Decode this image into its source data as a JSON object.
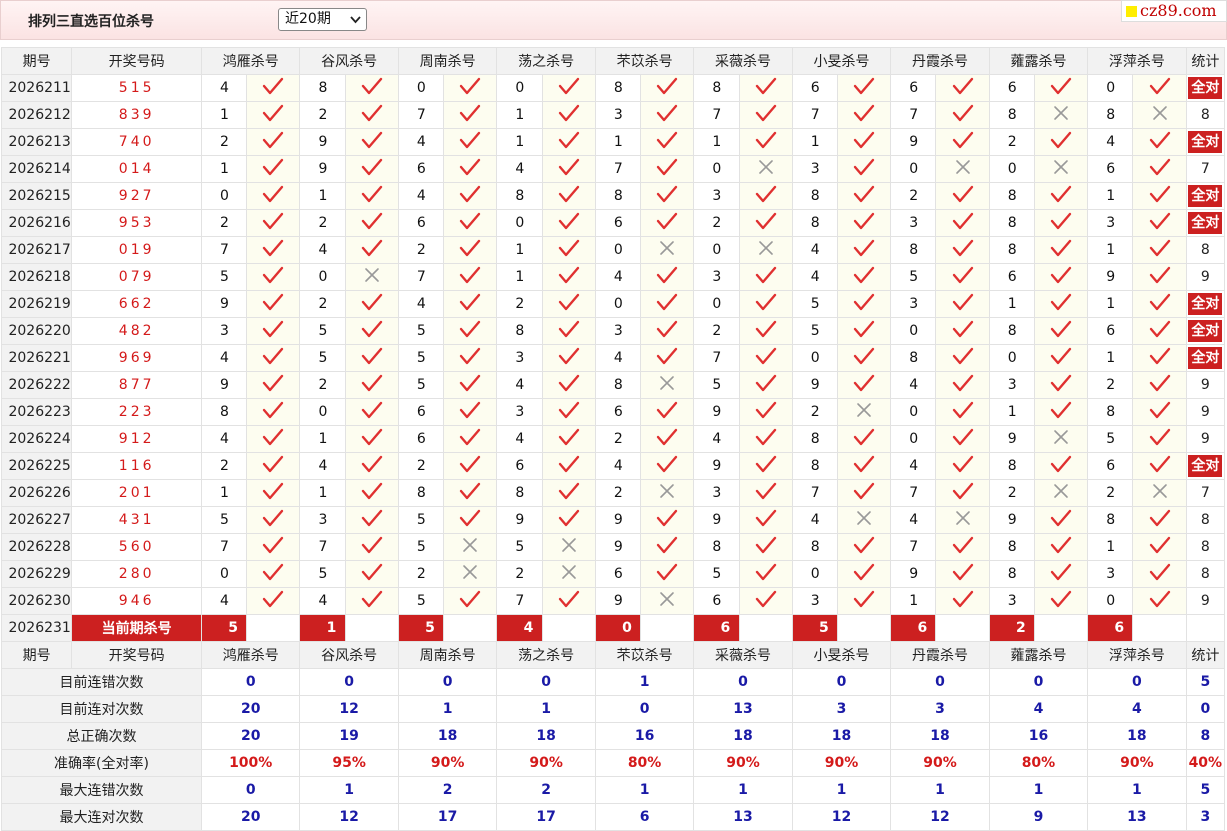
{
  "header": {
    "title": "排列三直选百位杀号",
    "period_select": "近20期",
    "watermark": "cz89.com"
  },
  "columns": {
    "issue": "期号",
    "draw": "开奖号码",
    "experts": [
      "鸿雁杀号",
      "谷风杀号",
      "周南杀号",
      "荡之杀号",
      "芣苡杀号",
      "采薇杀号",
      "小旻杀号",
      "丹霞杀号",
      "蕹露杀号",
      "浮萍杀号"
    ],
    "stat": "统计"
  },
  "rows": [
    {
      "issue": "2026211",
      "draw": "515",
      "kills": [
        4,
        8,
        0,
        0,
        8,
        8,
        6,
        6,
        6,
        0
      ],
      "hits": [
        1,
        1,
        1,
        1,
        1,
        1,
        1,
        1,
        1,
        1
      ],
      "stat": "全对"
    },
    {
      "issue": "2026212",
      "draw": "839",
      "kills": [
        1,
        2,
        7,
        1,
        3,
        7,
        7,
        7,
        8,
        8
      ],
      "hits": [
        1,
        1,
        1,
        1,
        1,
        1,
        1,
        1,
        0,
        0
      ],
      "stat": "8"
    },
    {
      "issue": "2026213",
      "draw": "740",
      "kills": [
        2,
        9,
        4,
        1,
        1,
        1,
        1,
        9,
        2,
        4
      ],
      "hits": [
        1,
        1,
        1,
        1,
        1,
        1,
        1,
        1,
        1,
        1
      ],
      "stat": "全对"
    },
    {
      "issue": "2026214",
      "draw": "014",
      "kills": [
        1,
        9,
        6,
        4,
        7,
        0,
        3,
        0,
        0,
        6
      ],
      "hits": [
        1,
        1,
        1,
        1,
        1,
        0,
        1,
        0,
        0,
        1
      ],
      "stat": "7"
    },
    {
      "issue": "2026215",
      "draw": "927",
      "kills": [
        0,
        1,
        4,
        8,
        8,
        3,
        8,
        2,
        8,
        1
      ],
      "hits": [
        1,
        1,
        1,
        1,
        1,
        1,
        1,
        1,
        1,
        1
      ],
      "stat": "全对"
    },
    {
      "issue": "2026216",
      "draw": "953",
      "kills": [
        2,
        2,
        6,
        0,
        6,
        2,
        8,
        3,
        8,
        3
      ],
      "hits": [
        1,
        1,
        1,
        1,
        1,
        1,
        1,
        1,
        1,
        1
      ],
      "stat": "全对"
    },
    {
      "issue": "2026217",
      "draw": "019",
      "kills": [
        7,
        4,
        2,
        1,
        0,
        0,
        4,
        8,
        8,
        1
      ],
      "hits": [
        1,
        1,
        1,
        1,
        0,
        0,
        1,
        1,
        1,
        1
      ],
      "stat": "8"
    },
    {
      "issue": "2026218",
      "draw": "079",
      "kills": [
        5,
        0,
        7,
        1,
        4,
        3,
        4,
        5,
        6,
        9
      ],
      "hits": [
        1,
        0,
        1,
        1,
        1,
        1,
        1,
        1,
        1,
        1
      ],
      "stat": "9"
    },
    {
      "issue": "2026219",
      "draw": "662",
      "kills": [
        9,
        2,
        4,
        2,
        0,
        0,
        5,
        3,
        1,
        1
      ],
      "hits": [
        1,
        1,
        1,
        1,
        1,
        1,
        1,
        1,
        1,
        1
      ],
      "stat": "全对"
    },
    {
      "issue": "2026220",
      "draw": "482",
      "kills": [
        3,
        5,
        5,
        8,
        3,
        2,
        5,
        0,
        8,
        6
      ],
      "hits": [
        1,
        1,
        1,
        1,
        1,
        1,
        1,
        1,
        1,
        1
      ],
      "stat": "全对"
    },
    {
      "issue": "2026221",
      "draw": "969",
      "kills": [
        4,
        5,
        5,
        3,
        4,
        7,
        0,
        8,
        0,
        1
      ],
      "hits": [
        1,
        1,
        1,
        1,
        1,
        1,
        1,
        1,
        1,
        1
      ],
      "stat": "全对"
    },
    {
      "issue": "2026222",
      "draw": "877",
      "kills": [
        9,
        2,
        5,
        4,
        8,
        5,
        9,
        4,
        3,
        2
      ],
      "hits": [
        1,
        1,
        1,
        1,
        0,
        1,
        1,
        1,
        1,
        1
      ],
      "stat": "9"
    },
    {
      "issue": "2026223",
      "draw": "223",
      "kills": [
        8,
        0,
        6,
        3,
        6,
        9,
        2,
        0,
        1,
        8
      ],
      "hits": [
        1,
        1,
        1,
        1,
        1,
        1,
        0,
        1,
        1,
        1
      ],
      "stat": "9"
    },
    {
      "issue": "2026224",
      "draw": "912",
      "kills": [
        4,
        1,
        6,
        4,
        2,
        4,
        8,
        0,
        9,
        5
      ],
      "hits": [
        1,
        1,
        1,
        1,
        1,
        1,
        1,
        1,
        0,
        1
      ],
      "stat": "9"
    },
    {
      "issue": "2026225",
      "draw": "116",
      "kills": [
        2,
        4,
        2,
        6,
        4,
        9,
        8,
        4,
        8,
        6
      ],
      "hits": [
        1,
        1,
        1,
        1,
        1,
        1,
        1,
        1,
        1,
        1
      ],
      "stat": "全对"
    },
    {
      "issue": "2026226",
      "draw": "201",
      "kills": [
        1,
        1,
        8,
        8,
        2,
        3,
        7,
        7,
        2,
        2
      ],
      "hits": [
        1,
        1,
        1,
        1,
        0,
        1,
        1,
        1,
        0,
        0
      ],
      "stat": "7"
    },
    {
      "issue": "2026227",
      "draw": "431",
      "kills": [
        5,
        3,
        5,
        9,
        9,
        9,
        4,
        4,
        9,
        8
      ],
      "hits": [
        1,
        1,
        1,
        1,
        1,
        1,
        0,
        0,
        1,
        1
      ],
      "stat": "8"
    },
    {
      "issue": "2026228",
      "draw": "560",
      "kills": [
        7,
        7,
        5,
        5,
        9,
        8,
        8,
        7,
        8,
        1
      ],
      "hits": [
        1,
        1,
        0,
        0,
        1,
        1,
        1,
        1,
        1,
        1
      ],
      "stat": "8"
    },
    {
      "issue": "2026229",
      "draw": "280",
      "kills": [
        0,
        5,
        2,
        2,
        6,
        5,
        0,
        9,
        8,
        3
      ],
      "hits": [
        1,
        1,
        0,
        0,
        1,
        1,
        1,
        1,
        1,
        1
      ],
      "stat": "8"
    },
    {
      "issue": "2026230",
      "draw": "946",
      "kills": [
        4,
        4,
        5,
        7,
        9,
        6,
        3,
        1,
        3,
        0
      ],
      "hits": [
        1,
        1,
        1,
        1,
        0,
        1,
        1,
        1,
        1,
        1
      ],
      "stat": "9"
    }
  ],
  "current": {
    "issue": "2026231",
    "label": "当前期杀号",
    "kills": [
      5,
      1,
      5,
      4,
      0,
      6,
      5,
      6,
      2,
      6
    ]
  },
  "metrics": [
    {
      "label": "目前连错次数",
      "values": [
        "0",
        "0",
        "0",
        "0",
        "1",
        "0",
        "0",
        "0",
        "0",
        "0"
      ],
      "stat": "5",
      "red": false
    },
    {
      "label": "目前连对次数",
      "values": [
        "20",
        "12",
        "1",
        "1",
        "0",
        "13",
        "3",
        "3",
        "4",
        "4"
      ],
      "stat": "0",
      "red": false
    },
    {
      "label": "总正确次数",
      "values": [
        "20",
        "19",
        "18",
        "18",
        "16",
        "18",
        "18",
        "18",
        "16",
        "18"
      ],
      "stat": "8",
      "red": false
    },
    {
      "label": "准确率(全对率)",
      "values": [
        "100%",
        "95%",
        "90%",
        "90%",
        "80%",
        "90%",
        "90%",
        "90%",
        "80%",
        "90%"
      ],
      "stat": "40%",
      "red": true
    },
    {
      "label": "最大连错次数",
      "values": [
        "0",
        "1",
        "2",
        "2",
        "1",
        "1",
        "1",
        "1",
        "1",
        "1"
      ],
      "stat": "5",
      "red": false
    },
    {
      "label": "最大连对次数",
      "values": [
        "20",
        "12",
        "17",
        "17",
        "6",
        "13",
        "12",
        "12",
        "9",
        "13"
      ],
      "stat": "3",
      "red": false
    }
  ],
  "icons": {
    "hit": "check-icon",
    "miss": "cross-icon"
  },
  "colors": {
    "accent_red": "#cc2020",
    "check": "#e03030",
    "cross": "#999999",
    "metric_blue": "#1a1aa6",
    "draw_red": "#d41a1a"
  }
}
